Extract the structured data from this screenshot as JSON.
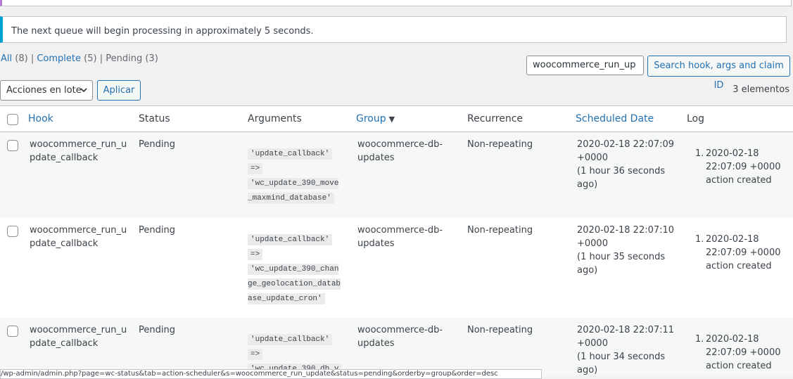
{
  "notice": {
    "text": "The next queue will begin processing in approximately 5 seconds."
  },
  "filters": {
    "all_label": "All",
    "all_count": "(8)",
    "complete_label": "Complete",
    "complete_count": "(5)",
    "pending_label": "Pending",
    "pending_count": "(3)"
  },
  "search": {
    "value": "woocommerce_run_up",
    "button_label": "Search hook, args and claim ID"
  },
  "bulk": {
    "selected": "Acciones en lote",
    "apply_label": "Aplicar"
  },
  "items_count": "3 elementos",
  "columns": {
    "hook": "Hook",
    "status": "Status",
    "arguments": "Arguments",
    "group": "Group",
    "recurrence": "Recurrence",
    "scheduled": "Scheduled Date",
    "log": "Log"
  },
  "rows": [
    {
      "hook": "woocommerce_run_update_callback",
      "status": "Pending",
      "arg_key": "'update_callback'",
      "arg_arrow": "=>",
      "arg_value": "'wc_update_390_move_maxmind_database'",
      "group": "woocommerce-db-updates",
      "recurrence": "Non-repeating",
      "date": "2020-02-18 22:07:09",
      "tz": "+0000",
      "rel": "(1 hour 36 seconds ago)",
      "log_num": "1.",
      "log_date": "2020-02-18 22:07:09 +0000",
      "log_msg": "action created"
    },
    {
      "hook": "woocommerce_run_update_callback",
      "status": "Pending",
      "arg_key": "'update_callback'",
      "arg_arrow": "=>",
      "arg_value": "'wc_update_390_change_geolocation_database_update_cron'",
      "group": "woocommerce-db-updates",
      "recurrence": "Non-repeating",
      "date": "2020-02-18 22:07:10",
      "tz": "+0000",
      "rel": "(1 hour 35 seconds ago)",
      "log_num": "1.",
      "log_date": "2020-02-18 22:07:09 +0000",
      "log_msg": "action created"
    },
    {
      "hook": "woocommerce_run_update_callback",
      "status": "Pending",
      "arg_key": "'update_callback'",
      "arg_arrow": "=>",
      "arg_value": "'wc_update_390_db_v",
      "group": "woocommerce-db-updates",
      "recurrence": "Non-repeating",
      "date": "2020-02-18 22:07:11",
      "tz": "+0000",
      "rel": "(1 hour 34 seconds ago)",
      "log_num": "1.",
      "log_date": "2020-02-18 22:07:09 +0000",
      "log_msg": "action created"
    }
  ],
  "status_url": "/wp-admin/admin.php?page=wc-status&tab=action-scheduler&s=woocommerce_run_update&status=pending&orderby=group&order=desc"
}
